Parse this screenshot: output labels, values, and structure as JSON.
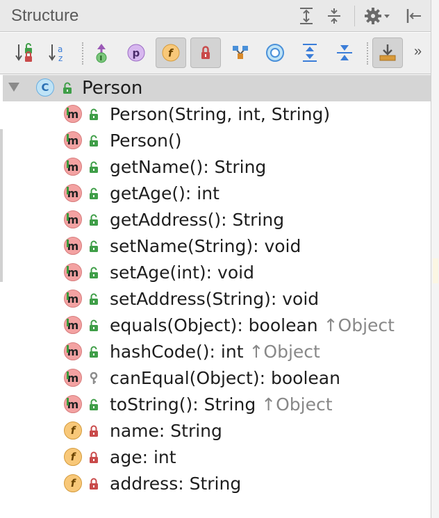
{
  "panel": {
    "title": "Structure"
  },
  "titlebar_buttons": [
    {
      "name": "expand-all-icon"
    },
    {
      "name": "collapse-all-icon"
    },
    {
      "name": "settings-gear-icon"
    },
    {
      "name": "hide-panel-icon"
    }
  ],
  "toolbar": {
    "tools": [
      {
        "name": "sort-by-visibility-button",
        "icon": "sort-visibility-icon",
        "active": false
      },
      {
        "name": "sort-alphabetically-button",
        "icon": "sort-az-icon",
        "active": false
      },
      {
        "name": "show-inherited-button",
        "icon": "inherited-icon",
        "active": false
      },
      {
        "name": "show-properties-button",
        "icon": "property-icon",
        "glyph": "p",
        "active": false
      },
      {
        "name": "show-fields-button",
        "icon": "field-icon",
        "glyph": "f",
        "active": true
      },
      {
        "name": "show-non-public-button",
        "icon": "lock-icon",
        "active": true
      },
      {
        "name": "show-hierarchy-button",
        "icon": "hierarchy-icon",
        "active": false
      },
      {
        "name": "show-anonymous-button",
        "icon": "anonymous-class-icon",
        "active": false
      },
      {
        "name": "expand-all-button",
        "icon": "expand-icon",
        "active": false
      },
      {
        "name": "collapse-all-button",
        "icon": "collapse-icon",
        "active": false
      },
      {
        "name": "autoscroll-from-source-button",
        "icon": "autoscroll-icon",
        "active": true
      }
    ],
    "more": "»"
  },
  "tree": {
    "root": {
      "kind": "class",
      "kind_glyph": "C",
      "visibility": "public",
      "label": "Person"
    },
    "members": [
      {
        "kind": "method",
        "kind_glyph": "m",
        "visibility": "public",
        "label": "Person(String, int, String)",
        "inherited": ""
      },
      {
        "kind": "method",
        "kind_glyph": "m",
        "visibility": "public",
        "label": "Person()",
        "inherited": ""
      },
      {
        "kind": "method",
        "kind_glyph": "m",
        "visibility": "public",
        "label": "getName(): String",
        "inherited": ""
      },
      {
        "kind": "method",
        "kind_glyph": "m",
        "visibility": "public",
        "label": "getAge(): int",
        "inherited": ""
      },
      {
        "kind": "method",
        "kind_glyph": "m",
        "visibility": "public",
        "label": "getAddress(): String",
        "inherited": ""
      },
      {
        "kind": "method",
        "kind_glyph": "m",
        "visibility": "public",
        "label": "setName(String): void",
        "inherited": ""
      },
      {
        "kind": "method",
        "kind_glyph": "m",
        "visibility": "public",
        "label": "setAge(int): void",
        "inherited": ""
      },
      {
        "kind": "method",
        "kind_glyph": "m",
        "visibility": "public",
        "label": "setAddress(String): void",
        "inherited": ""
      },
      {
        "kind": "method",
        "kind_glyph": "m",
        "visibility": "public",
        "label": "equals(Object): boolean",
        "inherited": "↑Object"
      },
      {
        "kind": "method",
        "kind_glyph": "m",
        "visibility": "public",
        "label": "hashCode(): int",
        "inherited": "↑Object"
      },
      {
        "kind": "method",
        "kind_glyph": "m",
        "visibility": "protected",
        "label": "canEqual(Object): boolean",
        "inherited": ""
      },
      {
        "kind": "method",
        "kind_glyph": "m",
        "visibility": "public",
        "label": "toString(): String",
        "inherited": "↑Object"
      },
      {
        "kind": "field",
        "kind_glyph": "f",
        "visibility": "private",
        "label": "name: String",
        "inherited": ""
      },
      {
        "kind": "field",
        "kind_glyph": "f",
        "visibility": "private",
        "label": "age: int",
        "inherited": ""
      },
      {
        "kind": "field",
        "kind_glyph": "f",
        "visibility": "private",
        "label": "address: String",
        "inherited": ""
      }
    ]
  },
  "colors": {
    "selected_row": "#d5d5d5",
    "public_lock": "#3f9e48",
    "private_lock": "#c94a4a",
    "protected_key": "#8c8c8c",
    "inherited_text": "#888888"
  }
}
